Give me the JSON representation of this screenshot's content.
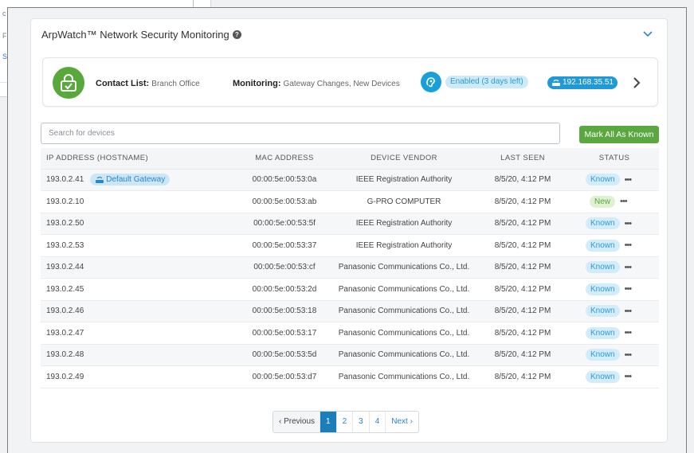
{
  "background": {
    "letters": [
      "c",
      "F",
      "S"
    ]
  },
  "card": {
    "title": "ArpWatch™ Network Security Monitoring",
    "help_icon": "?"
  },
  "summary": {
    "contact_label": "Contact List:",
    "contact_value": "Branch Office",
    "monitoring_label": "Monitoring:",
    "monitoring_value": "Gateway Changes, New Devices",
    "enabled_text": "Enabled (3 days left)",
    "ip_text": "192.168.35.51"
  },
  "search": {
    "placeholder": "Search for devices",
    "value": ""
  },
  "mark_all_label": "Mark All As Known",
  "table": {
    "headers": [
      "IP ADDRESS (HOSTNAME)",
      "MAC ADDRESS",
      "DEVICE VENDOR",
      "LAST SEEN",
      "STATUS"
    ],
    "rows": [
      {
        "ip": "193.0.2.41",
        "hostname": "Default Gateway",
        "mac": "00:00:5e:00:53:0a",
        "vendor": "IEEE Registration Authority",
        "seen": "8/5/20, 4:12 PM",
        "status": "Known"
      },
      {
        "ip": "193.0.2.10",
        "hostname": "",
        "mac": "00:00:5e:00:53:ab",
        "vendor": "G-PRO COMPUTER",
        "seen": "8/5/20, 4:12 PM",
        "status": "New"
      },
      {
        "ip": "193.0.2.50",
        "hostname": "",
        "mac": "00:00:5e:00:53:5f",
        "vendor": "IEEE Registration Authority",
        "seen": "8/5/20, 4:12 PM",
        "status": "Known"
      },
      {
        "ip": "193.0.2.53",
        "hostname": "",
        "mac": "00:00:5e:00:53:37",
        "vendor": "IEEE Registration Authority",
        "seen": "8/5/20, 4:12 PM",
        "status": "Known"
      },
      {
        "ip": "193.0.2.44",
        "hostname": "",
        "mac": "00:00:5e:00:53:cf",
        "vendor": "Panasonic Communications Co., Ltd.",
        "seen": "8/5/20, 4:12 PM",
        "status": "Known"
      },
      {
        "ip": "193.0.2.45",
        "hostname": "",
        "mac": "00:00:5e:00:53:2d",
        "vendor": "Panasonic Communications Co., Ltd.",
        "seen": "8/5/20, 4:12 PM",
        "status": "Known"
      },
      {
        "ip": "193.0.2.46",
        "hostname": "",
        "mac": "00:00:5e:00:53:18",
        "vendor": "Panasonic Communications Co., Ltd.",
        "seen": "8/5/20, 4:12 PM",
        "status": "Known"
      },
      {
        "ip": "193.0.2.47",
        "hostname": "",
        "mac": "00:00:5e:00:53:17",
        "vendor": "Panasonic Communications Co., Ltd.",
        "seen": "8/5/20, 4:12 PM",
        "status": "Known"
      },
      {
        "ip": "193.0.2.48",
        "hostname": "",
        "mac": "00:00:5e:00:53:5d",
        "vendor": "Panasonic Communications Co., Ltd.",
        "seen": "8/5/20, 4:12 PM",
        "status": "Known"
      },
      {
        "ip": "193.0.2.49",
        "hostname": "",
        "mac": "00:00:5e:00:53:d7",
        "vendor": "Panasonic Communications Co., Ltd.",
        "seen": "8/5/20, 4:12 PM",
        "status": "Known"
      }
    ],
    "more_icon": "•••"
  },
  "pagination": {
    "prev_label": "‹ Previous",
    "pages": [
      "1",
      "2",
      "3",
      "4"
    ],
    "active_page": "1",
    "next_label": "Next ›"
  },
  "icons": {
    "collapse": "chevron-down-icon",
    "lock": "lock-icon",
    "enabled": "ear-shield-icon",
    "ip": "router-icon",
    "summary_next": "chevron-right-icon"
  },
  "colors": {
    "accent_green": "#5aa83f",
    "accent_blue": "#1f9ad6",
    "known_badge": "#d2ecf9",
    "new_badge": "#dff0d3",
    "active_page": "#1a7fb8"
  }
}
